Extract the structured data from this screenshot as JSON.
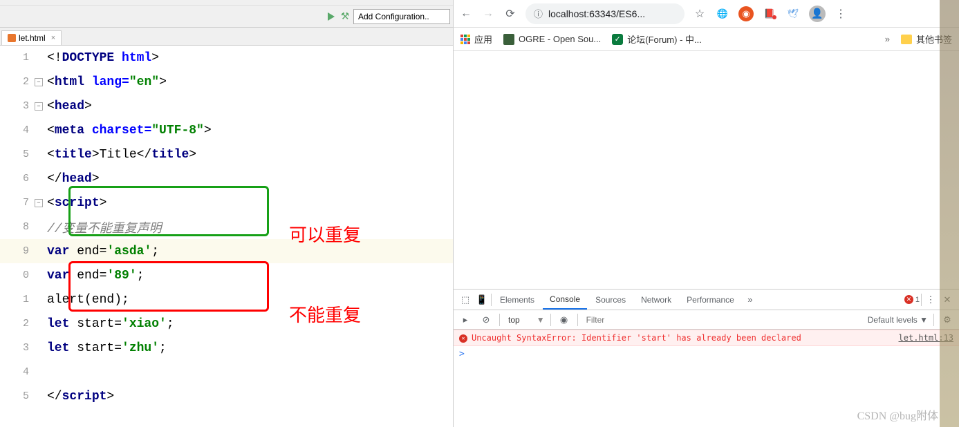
{
  "ide": {
    "menu": [
      "",
      "",
      "",
      "",
      "",
      ""
    ],
    "config_label": "Add Configuration..",
    "tab_filename": "let.html",
    "lines": [
      "1",
      "2",
      "3",
      "4",
      "5",
      "6",
      "7",
      "8",
      "9",
      "0",
      "1",
      "2",
      "3",
      "4",
      "5"
    ],
    "code": {
      "l1_a": "<!",
      "l1_b": "DOCTYPE ",
      "l1_c": "html",
      "l1_d": ">",
      "l2_a": "<",
      "l2_b": "html ",
      "l2_c": "lang=",
      "l2_d": "\"en\"",
      "l2_e": ">",
      "l3_a": "<",
      "l3_b": "head",
      "l3_c": ">",
      "l4_a": "<",
      "l4_b": "meta ",
      "l4_c": "charset=",
      "l4_d": "\"UTF-8\"",
      "l4_e": ">",
      "l5_a": "<",
      "l5_b": "title",
      "l5_c": ">",
      "l5_d": "Title",
      "l5_e": "</",
      "l5_f": "title",
      "l5_g": ">",
      "l6_a": "</",
      "l6_b": "head",
      "l6_c": ">",
      "l7_a": "<",
      "l7_b": "script",
      "l7_c": ">",
      "l8": "//变量不能重复声明",
      "l9_a": "var ",
      "l9_b": "end=",
      "l9_c": "'asda'",
      "l9_d": ";",
      "l10_a": "var ",
      "l10_b": "end=",
      "l10_c": "'89'",
      "l10_d": ";",
      "l11": "alert(end);",
      "l12_a": "let ",
      "l12_b": "start=",
      "l12_c": "'xiao'",
      "l12_d": ";",
      "l13_a": "let ",
      "l13_b": "start=",
      "l13_c": "'zhu'",
      "l13_d": ";",
      "l15_a": "</",
      "l15_b": "script",
      "l15_c": ">"
    },
    "annotation_green": "可以重复",
    "annotation_red": "不能重复"
  },
  "browser": {
    "url": "localhost:63343/ES6...",
    "bookmarks": {
      "apps": "应用",
      "ogre": "OGRE - Open Sou...",
      "forum": "论坛(Forum) - 中...",
      "other": "其他书签"
    }
  },
  "devtools": {
    "tabs": {
      "elements": "Elements",
      "console": "Console",
      "sources": "Sources",
      "network": "Network",
      "performance": "Performance"
    },
    "error_count": "1",
    "context": "top",
    "filter_placeholder": "Filter",
    "levels": "Default levels ▼",
    "error_msg": "Uncaught SyntaxError: Identifier 'start' has already been declared",
    "error_src": "let.html:13",
    "prompt": ">"
  },
  "watermark": "CSDN @bug附体"
}
